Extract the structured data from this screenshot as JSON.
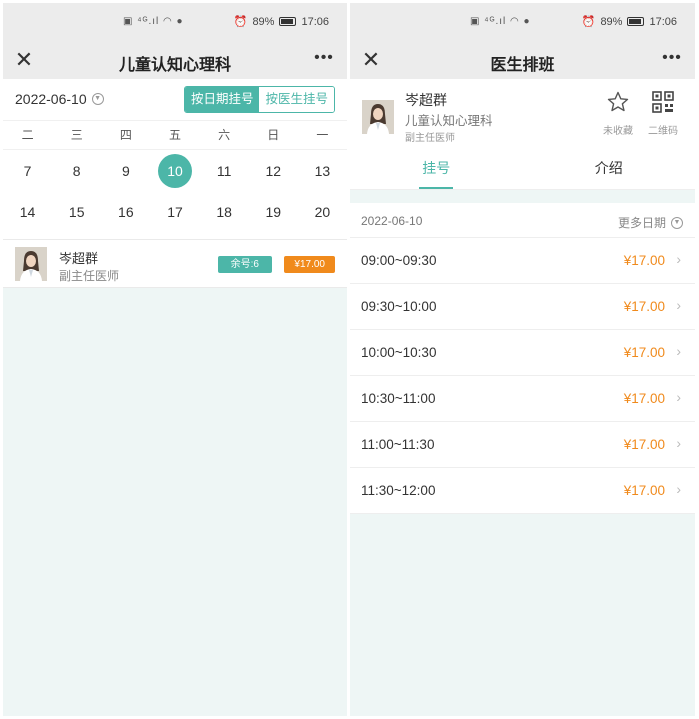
{
  "status": {
    "time": "17:06",
    "battery": "89%"
  },
  "left": {
    "title": "儿童认知心理科",
    "date": "2022-06-10",
    "segments": {
      "by_date": "按日期挂号",
      "by_doctor": "按医生挂号"
    },
    "weekdays": [
      "二",
      "三",
      "四",
      "五",
      "六",
      "日",
      "一"
    ],
    "week1": [
      "7",
      "8",
      "9",
      "10",
      "11",
      "12",
      "13"
    ],
    "week2": [
      "14",
      "15",
      "16",
      "17",
      "18",
      "19",
      "20"
    ],
    "selected_day": "10",
    "doctor": {
      "name": "岑超群",
      "title": "副主任医师",
      "remaining": "余号:6",
      "price": "¥17.00"
    }
  },
  "right": {
    "title": "医生排班",
    "doctor": {
      "name": "岑超群",
      "dept": "儿童认知心理科",
      "title": "副主任医师"
    },
    "favorite_label": "未收藏",
    "qr_label": "二维码",
    "tabs": [
      "挂号",
      "介绍"
    ],
    "schedule_date": "2022-06-10",
    "more_dates": "更多日期",
    "slots": [
      {
        "time": "09:00~09:30",
        "price": "¥17.00"
      },
      {
        "time": "09:30~10:00",
        "price": "¥17.00"
      },
      {
        "time": "10:00~10:30",
        "price": "¥17.00"
      },
      {
        "time": "10:30~11:00",
        "price": "¥17.00"
      },
      {
        "time": "11:00~11:30",
        "price": "¥17.00"
      },
      {
        "time": "11:30~12:00",
        "price": "¥17.00"
      }
    ]
  },
  "colors": {
    "accent": "#4cb6a8",
    "price": "#f08a1c"
  }
}
